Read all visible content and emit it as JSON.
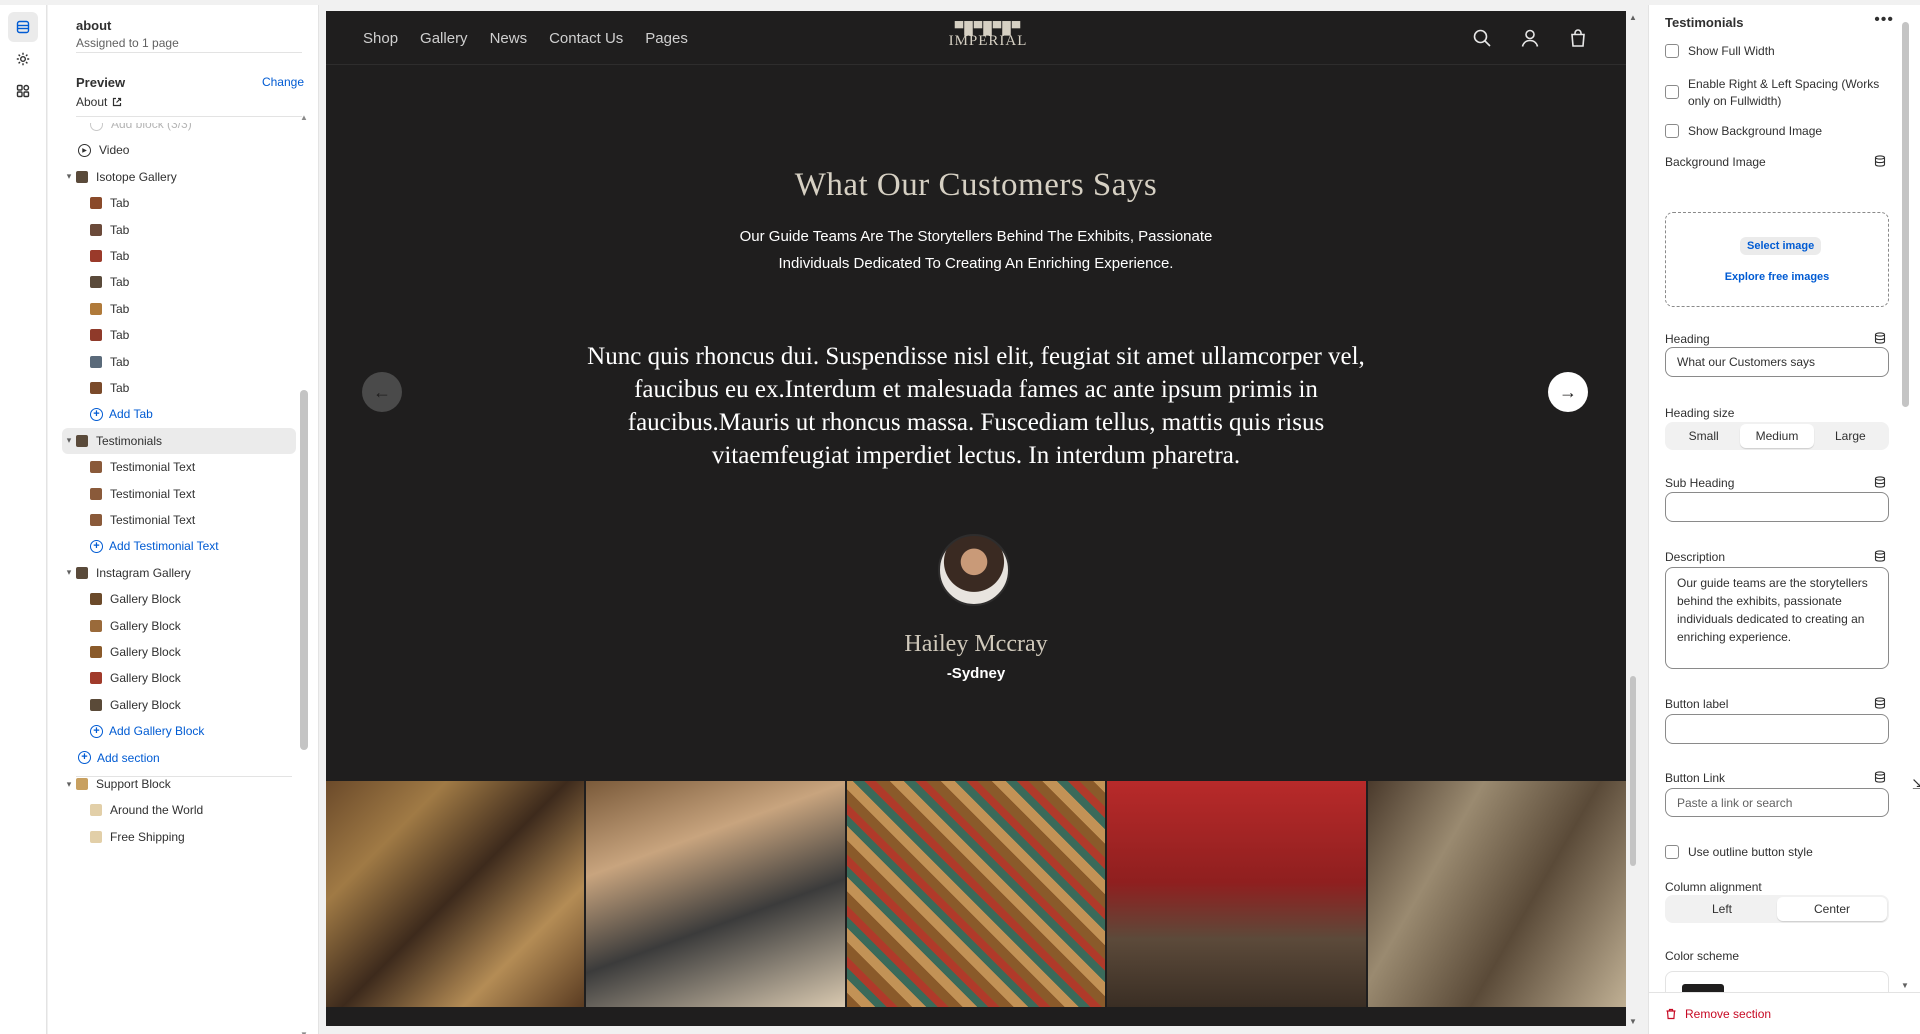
{
  "rail": {
    "items": [
      {
        "icon": "sections-icon"
      },
      {
        "icon": "gear-icon"
      },
      {
        "icon": "apps-icon"
      }
    ]
  },
  "left_panel": {
    "page_title": "about",
    "page_sub": "Assigned to 1 page",
    "preview_label": "Preview",
    "change_label": "Change",
    "preview_value": "About",
    "tree": [
      {
        "label": "Add block (3/3)",
        "kind": "faded"
      },
      {
        "label": "Video",
        "kind": "video"
      },
      {
        "label": "Isotope Gallery",
        "kind": "section"
      },
      {
        "label": "Tab",
        "kind": "child",
        "color": "#8a4a2a"
      },
      {
        "label": "Tab",
        "kind": "child",
        "color": "#6b4a3a"
      },
      {
        "label": "Tab",
        "kind": "child",
        "color": "#9a3a2a"
      },
      {
        "label": "Tab",
        "kind": "child",
        "color": "#5a4a3a"
      },
      {
        "label": "Tab",
        "kind": "child",
        "color": "#b07a3a"
      },
      {
        "label": "Tab",
        "kind": "child",
        "color": "#8f3a2a"
      },
      {
        "label": "Tab",
        "kind": "child",
        "color": "#5a6a7a"
      },
      {
        "label": "Tab",
        "kind": "child",
        "color": "#7a4a2a"
      },
      {
        "label": "Add Tab",
        "kind": "add-child"
      },
      {
        "label": "Testimonials",
        "kind": "section-selected"
      },
      {
        "label": "Testimonial Text",
        "kind": "child",
        "color": "#8a5a3a"
      },
      {
        "label": "Testimonial Text",
        "kind": "child",
        "color": "#8a5a3a"
      },
      {
        "label": "Testimonial Text",
        "kind": "child",
        "color": "#8a5a3a"
      },
      {
        "label": "Add Testimonial Text",
        "kind": "add-child"
      },
      {
        "label": "Instagram Gallery",
        "kind": "section"
      },
      {
        "label": "Gallery Block",
        "kind": "child",
        "color": "#6b4a2a"
      },
      {
        "label": "Gallery Block",
        "kind": "child",
        "color": "#9a6a3a"
      },
      {
        "label": "Gallery Block",
        "kind": "child",
        "color": "#8a5a2a"
      },
      {
        "label": "Gallery Block",
        "kind": "child",
        "color": "#a03a2a"
      },
      {
        "label": "Gallery Block",
        "kind": "child",
        "color": "#5a4a38"
      },
      {
        "label": "Add Gallery Block",
        "kind": "add-child"
      },
      {
        "label": "Add section",
        "kind": "add-section"
      },
      {
        "label": "Support Block",
        "kind": "section-support"
      },
      {
        "label": "Around the World",
        "kind": "child-light"
      },
      {
        "label": "Free Shipping",
        "kind": "child-light"
      }
    ]
  },
  "preview": {
    "nav_links": [
      "Shop",
      "Gallery",
      "News",
      "Contact Us",
      "Pages"
    ],
    "logo_text": "IMPERIAL",
    "heading": "What Our Customers Says",
    "description": "Our Guide Teams Are The Storytellers Behind The Exhibits, Passionate Individuals Dedicated To Creating An Enriching Experience.",
    "quote": "Nunc quis rhoncus dui. Suspendisse nisl elit, feugiat sit amet ullamcorper vel, faucibus eu ex.Interdum et malesuada fames ac ante ipsum primis in faucibus.Mauris ut rhoncus massa. Fuscediam tellus, mattis quis risus vitaemfeugiat imperdiet lectus. In interdum pharetra.",
    "author": "Hailey Mccray",
    "location": "-Sydney",
    "colors": {
      "background": "#1f1e1e",
      "heading": "#d6d0c3"
    }
  },
  "right_panel": {
    "title": "Testimonials",
    "show_full_width": "Show Full Width",
    "enable_spacing": "Enable Right & Left Spacing (Works only on Fullwidth)",
    "show_bg_image": "Show Background Image",
    "bg_image_label": "Background Image",
    "select_image": "Select image",
    "explore_images": "Explore free images",
    "heading_label": "Heading",
    "heading_value": "What our Customers says",
    "heading_size_label": "Heading size",
    "heading_sizes": [
      "Small",
      "Medium",
      "Large"
    ],
    "heading_size_selected": "Medium",
    "subheading_label": "Sub Heading",
    "subheading_value": "",
    "description_label": "Description",
    "description_value": "Our guide teams are the storytellers behind the exhibits, passionate individuals dedicated to creating an enriching experience.",
    "button_label_label": "Button label",
    "button_label_value": "",
    "button_link_label": "Button Link",
    "button_link_placeholder": "Paste a link or search",
    "outline_button": "Use outline button style",
    "column_alignment_label": "Column alignment",
    "alignments": [
      "Left",
      "Center"
    ],
    "alignment_selected": "Center",
    "color_scheme_label": "Color scheme",
    "remove_section": "Remove section"
  }
}
